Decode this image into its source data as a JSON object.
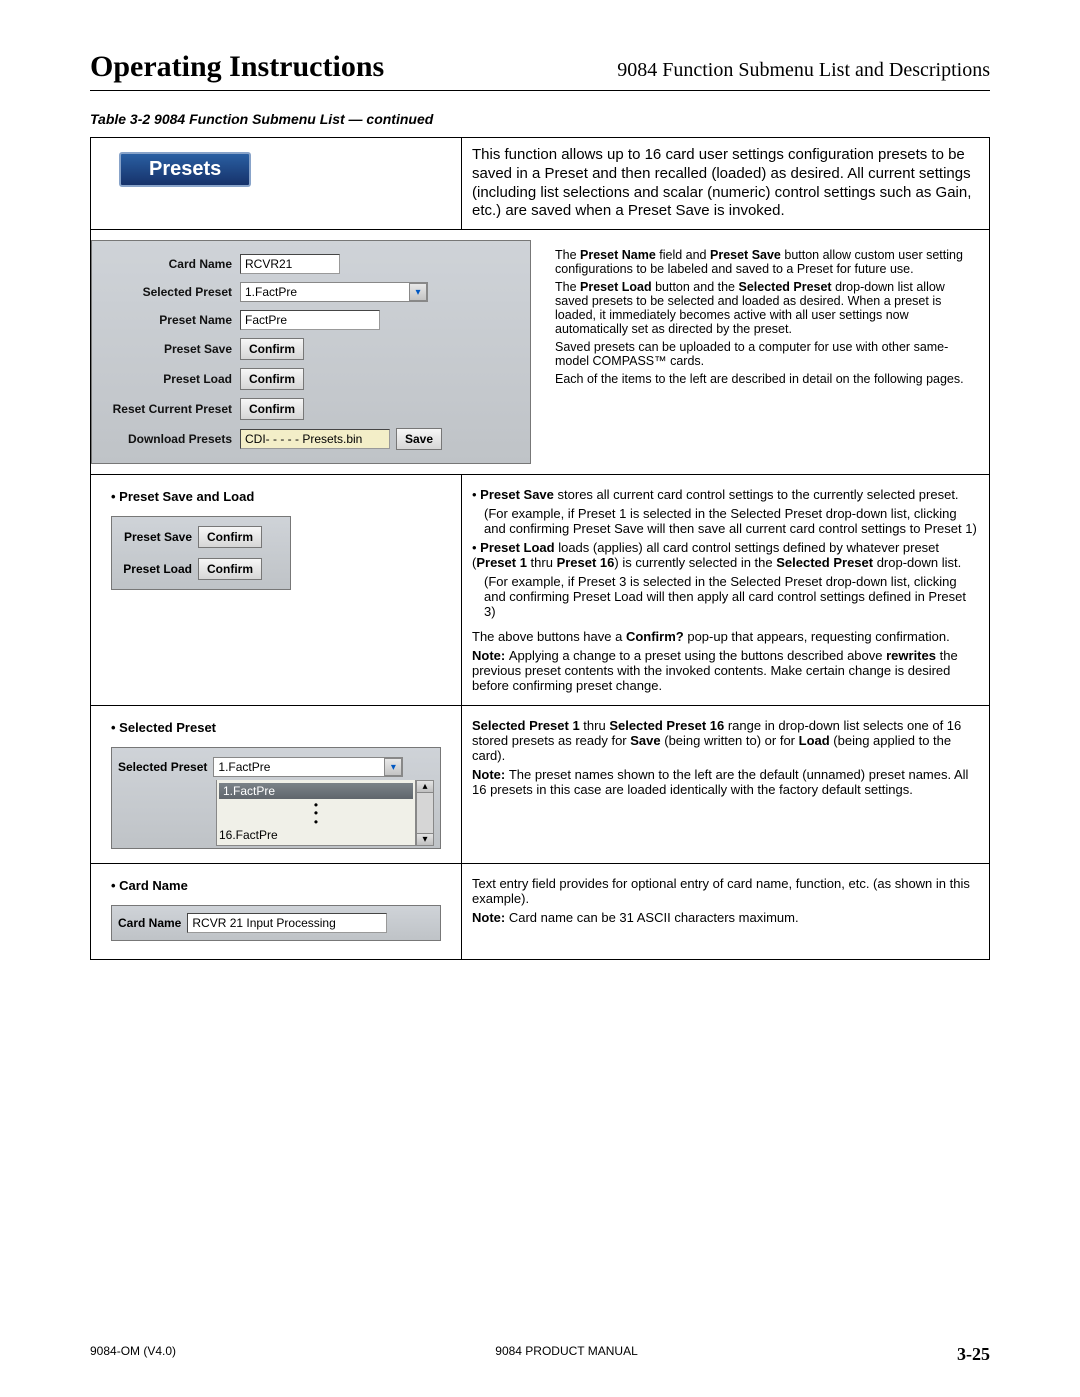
{
  "header": {
    "left": "Operating Instructions",
    "right": "9084 Function Submenu List and Descriptions"
  },
  "caption": "Table 3-2    9084 Function Submenu List — continued",
  "row1": {
    "tab": "Presets",
    "desc": "This function allows up to 16 card user settings configuration presets to be saved in a Preset and then recalled (loaded) as desired. All current settings (including list selections and scalar (numeric) control settings such as Gain, etc.) are saved when a Preset Save is invoked."
  },
  "row2": {
    "labels": {
      "cardName": "Card Name",
      "selectedPreset": "Selected Preset",
      "presetName": "Preset Name",
      "presetSave": "Preset Save",
      "presetLoad": "Preset Load",
      "resetCurrent": "Reset Current Preset",
      "download": "Download Presets"
    },
    "values": {
      "cardName": "RCVR21",
      "selectedPreset": "1.FactPre",
      "presetName": "FactPre",
      "downloadFile": "CDI- - - - -  Presets.bin"
    },
    "btn": {
      "confirm": "Confirm",
      "save": "Save"
    },
    "side": {
      "p1a": "The ",
      "p1b": "Preset Name",
      "p1c": " field and ",
      "p1d": "Preset Save",
      "p1e": " button allow custom user setting configurations to be labeled and saved to a Preset for future use.",
      "p2a": "The ",
      "p2b": "Preset Load",
      "p2c": " button and the ",
      "p2d": "Selected Preset",
      "p2e": " drop-down list allow saved presets to be selected and loaded as desired. When a preset is loaded, it immediately becomes active with all user settings now automatically set as directed by the preset.",
      "p3": "Saved presets can be uploaded to a computer for use with other same-model COMPASS™ cards.",
      "p4": "Each of the items to the left are described in detail on the following pages."
    }
  },
  "row3": {
    "heading": "• Preset Save and Load",
    "labels": {
      "presetSave": "Preset Save",
      "presetLoad": "Preset Load"
    },
    "btn": "Confirm",
    "r1a": "• ",
    "r1b": "Preset Save",
    "r1c": " stores all current card control settings to the currently selected preset.",
    "r2": "(For example, if Preset 1 is selected in the Selected Preset drop-down list, clicking and confirming Preset Save will then save all current card control settings to Preset 1)",
    "r3a": "• ",
    "r3b": "Preset Load",
    "r3c": " loads (applies) all card control settings defined by whatever preset (",
    "r3d": "Preset 1",
    "r3e": " thru ",
    "r3f": "Preset 16",
    "r3g": ") is currently selected in the ",
    "r3h": "Selected Preset",
    "r3i": " drop-down list.",
    "r4": "(For example, if Preset 3 is selected in the Selected Preset drop-down list, clicking and confirming Preset Load will then apply all card control settings defined in Preset 3)",
    "r5a": "The above buttons have a ",
    "r5b": "Confirm?",
    "r5c": " pop-up that appears, requesting confirmation.",
    "r6a": "Note: ",
    "r6b": "Applying a change to a preset using the buttons described above ",
    "r6c": "rewrites",
    "r6d": " the previous preset contents with the invoked contents. Make certain change is desired before confirming preset change."
  },
  "row4": {
    "heading": "• Selected Preset",
    "label": "Selected Preset",
    "value": "1.FactPre",
    "opt1": "1.FactPre",
    "opt2": "16.FactPre",
    "r1a": "Selected Preset 1",
    "r1b": " thru ",
    "r1c": "Selected Preset 16",
    "r1d": " range in drop-down list selects one of 16 stored presets as ready for ",
    "r1e": "Save",
    "r1f": " (being written to) or for ",
    "r1g": "Load",
    "r1h": " (being applied to the card).",
    "r2a": "Note: ",
    "r2b": "The preset names shown to the left are the default (unnamed) preset names. All 16 presets in this case are loaded identically with the factory default settings."
  },
  "row5": {
    "heading": "• Card Name",
    "label": "Card Name",
    "value": "RCVR 21 Input Processing",
    "r1": "Text entry field provides for optional entry of card name, function, etc. (as shown in this example).",
    "r2a": "Note: ",
    "r2b": "Card name can be 31 ASCII characters maximum."
  },
  "footer": {
    "left": "9084-OM  (V4.0)",
    "center": "9084 PRODUCT MANUAL",
    "right": "3-25"
  }
}
